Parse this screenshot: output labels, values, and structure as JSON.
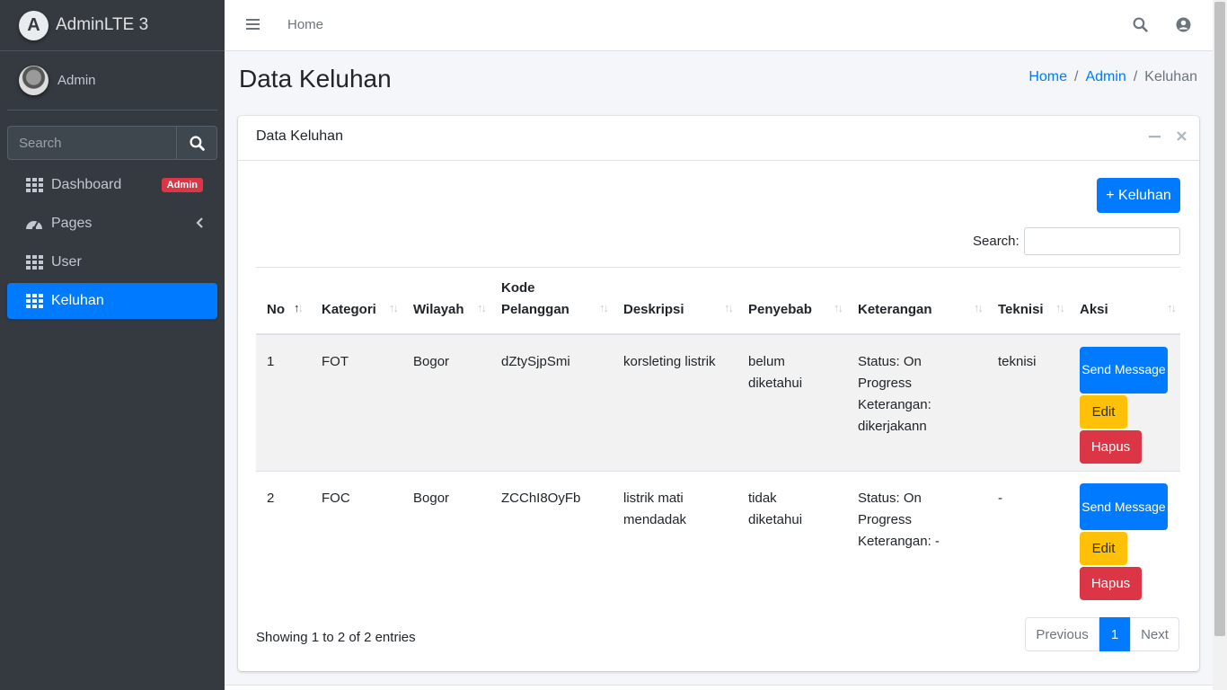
{
  "brand": {
    "logo_letter": "A",
    "name": "AdminLTE 3"
  },
  "user": {
    "name": "Admin"
  },
  "sidebar_search": {
    "placeholder": "Search"
  },
  "nav": {
    "dashboard": {
      "label": "Dashboard",
      "badge": "Admin"
    },
    "pages": {
      "label": "Pages"
    },
    "user": {
      "label": "User"
    },
    "keluhan": {
      "label": "Keluhan"
    }
  },
  "topbar": {
    "home": "Home"
  },
  "page": {
    "title": "Data Keluhan",
    "breadcrumb": [
      "Home",
      "Admin",
      "Keluhan"
    ]
  },
  "card": {
    "title": "Data Keluhan",
    "add_button": "+ Keluhan",
    "search_label": "Search:",
    "columns": [
      "No",
      "Kategori",
      "Wilayah",
      "Kode Pelanggan",
      "Deskripsi",
      "Penyebab",
      "Keterangan",
      "Teknisi",
      "Aksi"
    ],
    "rows": [
      {
        "no": "1",
        "kategori": "FOT",
        "wilayah": "Bogor",
        "kode": "dZtySjpSmi",
        "deskripsi": "korsleting listrik",
        "penyebab": "belum diketahui",
        "keterangan": "Status: On Progress Keterangan: dikerjakann",
        "teknisi": "teknisi"
      },
      {
        "no": "2",
        "kategori": "FOC",
        "wilayah": "Bogor",
        "kode": "ZCChI8OyFb",
        "deskripsi": "listrik mati mendadak",
        "penyebab": "tidak diketahui",
        "keterangan": "Status: On Progress Keterangan: -",
        "teknisi": "-"
      }
    ],
    "actions": {
      "send": "Send Message",
      "edit": "Edit",
      "hapus": "Hapus"
    },
    "info": "Showing 1 to 2 of 2 entries",
    "pager": {
      "previous": "Previous",
      "current": "1",
      "next": "Next"
    }
  },
  "colors": {
    "primary": "#007bff",
    "warning": "#ffc107",
    "danger": "#dc3545",
    "sidebar": "#343a40"
  }
}
